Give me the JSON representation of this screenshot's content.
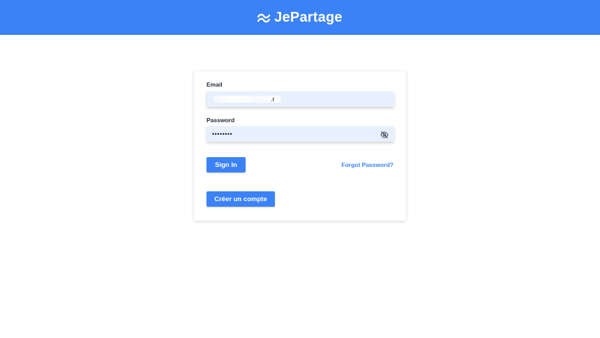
{
  "header": {
    "brand_name": "JePartage",
    "brand_icon": "waves-icon",
    "background_color": "#3b82f6"
  },
  "login_form": {
    "email": {
      "label": "Email",
      "value": "",
      "visible_fragment": ".r"
    },
    "password": {
      "label": "Password",
      "value": "••••••••",
      "toggle_icon": "eye-off-icon"
    },
    "sign_in_label": "Sign In",
    "forgot_password_label": "Forgot Password?",
    "create_account_label": "Créer un compte",
    "accent_color": "#3b82f6",
    "field_background": "#e8f0fe"
  }
}
